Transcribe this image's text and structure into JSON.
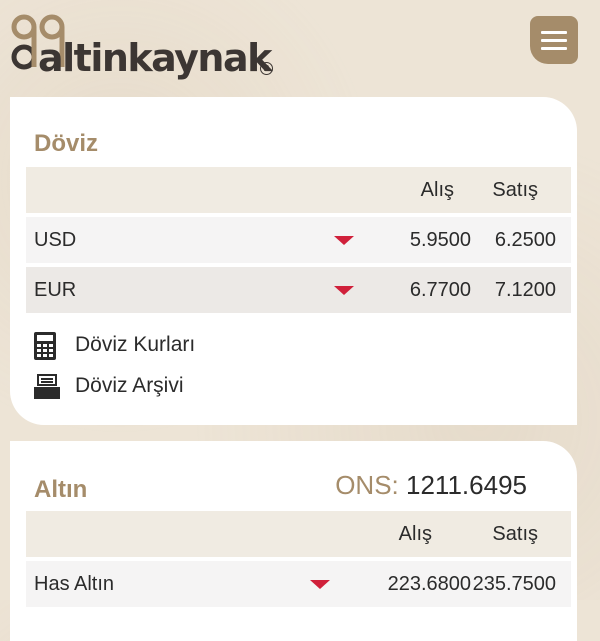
{
  "brand": {
    "name": "altinkaynak"
  },
  "header": {
    "menu_icon": "hamburger-menu-icon"
  },
  "doviz": {
    "title": "Döviz",
    "columns": {
      "alis": "Alış",
      "satis": "Satış"
    },
    "rows": [
      {
        "name": "USD",
        "alis": "5.9500",
        "satis": "6.2500",
        "trend": "down"
      },
      {
        "name": "EUR",
        "alis": "6.7700",
        "satis": "7.1200",
        "trend": "down"
      }
    ],
    "links": [
      {
        "label": "Döviz Kurları",
        "icon": "calculator-icon"
      },
      {
        "label": "Döviz Arşivi",
        "icon": "archive-icon"
      }
    ]
  },
  "altin": {
    "title": "Altın",
    "ons_label": "ONS:",
    "ons_value": "1211.6495",
    "columns": {
      "alis": "Alış",
      "satis": "Satış"
    },
    "rows": [
      {
        "name": "Has Altın",
        "alis": "223.6800",
        "satis": "235.7500",
        "trend": "down"
      }
    ]
  },
  "colors": {
    "accent": "#a58c6a",
    "down": "#d0203a",
    "background": "#ede4d6"
  }
}
